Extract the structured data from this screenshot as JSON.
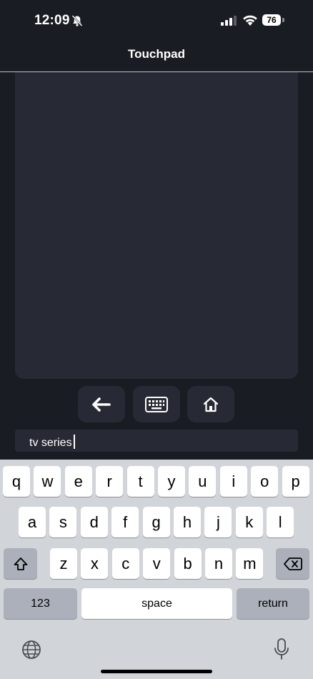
{
  "status": {
    "time": "12:09",
    "battery": "76"
  },
  "nav": {
    "title": "Touchpad"
  },
  "controls": [
    "back-arrow-icon",
    "keyboard-icon",
    "home-icon"
  ],
  "input": {
    "value": "tv series"
  },
  "keyboard": {
    "row1": [
      "q",
      "w",
      "e",
      "r",
      "t",
      "y",
      "u",
      "i",
      "o",
      "p"
    ],
    "row2": [
      "a",
      "s",
      "d",
      "f",
      "g",
      "h",
      "j",
      "k",
      "l"
    ],
    "row3": [
      "z",
      "x",
      "c",
      "v",
      "b",
      "n",
      "m"
    ],
    "numbers_label": "123",
    "space_label": "space",
    "return_label": "return"
  },
  "colors": {
    "background": "#191c22",
    "panel": "#272a34",
    "keyboard_bg": "#d1d4d9",
    "key": "#ffffff",
    "key_dark": "#abb0ba"
  }
}
